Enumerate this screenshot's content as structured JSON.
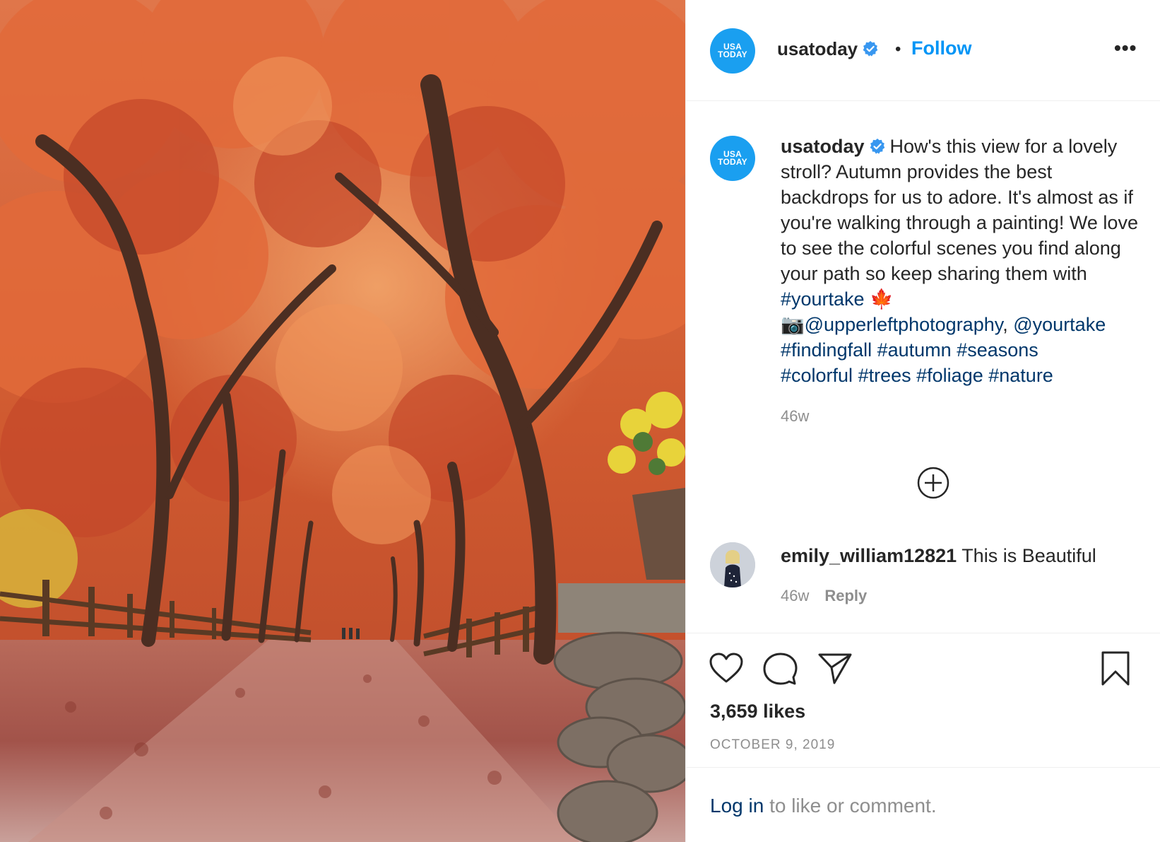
{
  "post": {
    "author": "usatoday",
    "avatar_text_line1": "USA",
    "avatar_text_line2": "TODAY",
    "follow_label": "Follow",
    "dot": "•",
    "more_label": "•••"
  },
  "caption": {
    "user": "usatoday",
    "line1": "How's this view for a lovely stroll? Autumn provides the best backdrops for us to adore. It's almost as if you're walking through a painting! We love to see the colorful scenes you find along your path so keep sharing them with ",
    "tag_yourtake": "#yourtake",
    "leaf_emoji": "🍁",
    "camera_emoji": "📷",
    "mention1": "@upperleftphotography",
    "comma": ", ",
    "mention2": "@yourtake",
    "tag1": "#findingfall",
    "tag2": "#autumn",
    "tag3": "#seasons",
    "tag4": "#colorful",
    "tag5": "#trees",
    "tag6": "#foliage",
    "tag7": "#nature",
    "time": "46w"
  },
  "comment": {
    "user": "emily_william12821",
    "text": "This is Beautiful",
    "time": "46w",
    "reply_label": "Reply"
  },
  "stats": {
    "likes": "3,659 likes",
    "date": "OCTOBER 9, 2019"
  },
  "footer": {
    "login_link": "Log in",
    "login_rest": " to like or comment."
  },
  "icons": {
    "like": "heart-icon",
    "comment": "comment-icon",
    "share": "paper-plane-icon",
    "save": "bookmark-icon",
    "load_more": "plus-circle-icon",
    "verified": "verified-badge-icon"
  },
  "colors": {
    "link_blue": "#0095f6",
    "tag_blue": "#00376b",
    "avatar_blue": "#1a9ff0",
    "muted": "#8e8e8e"
  }
}
